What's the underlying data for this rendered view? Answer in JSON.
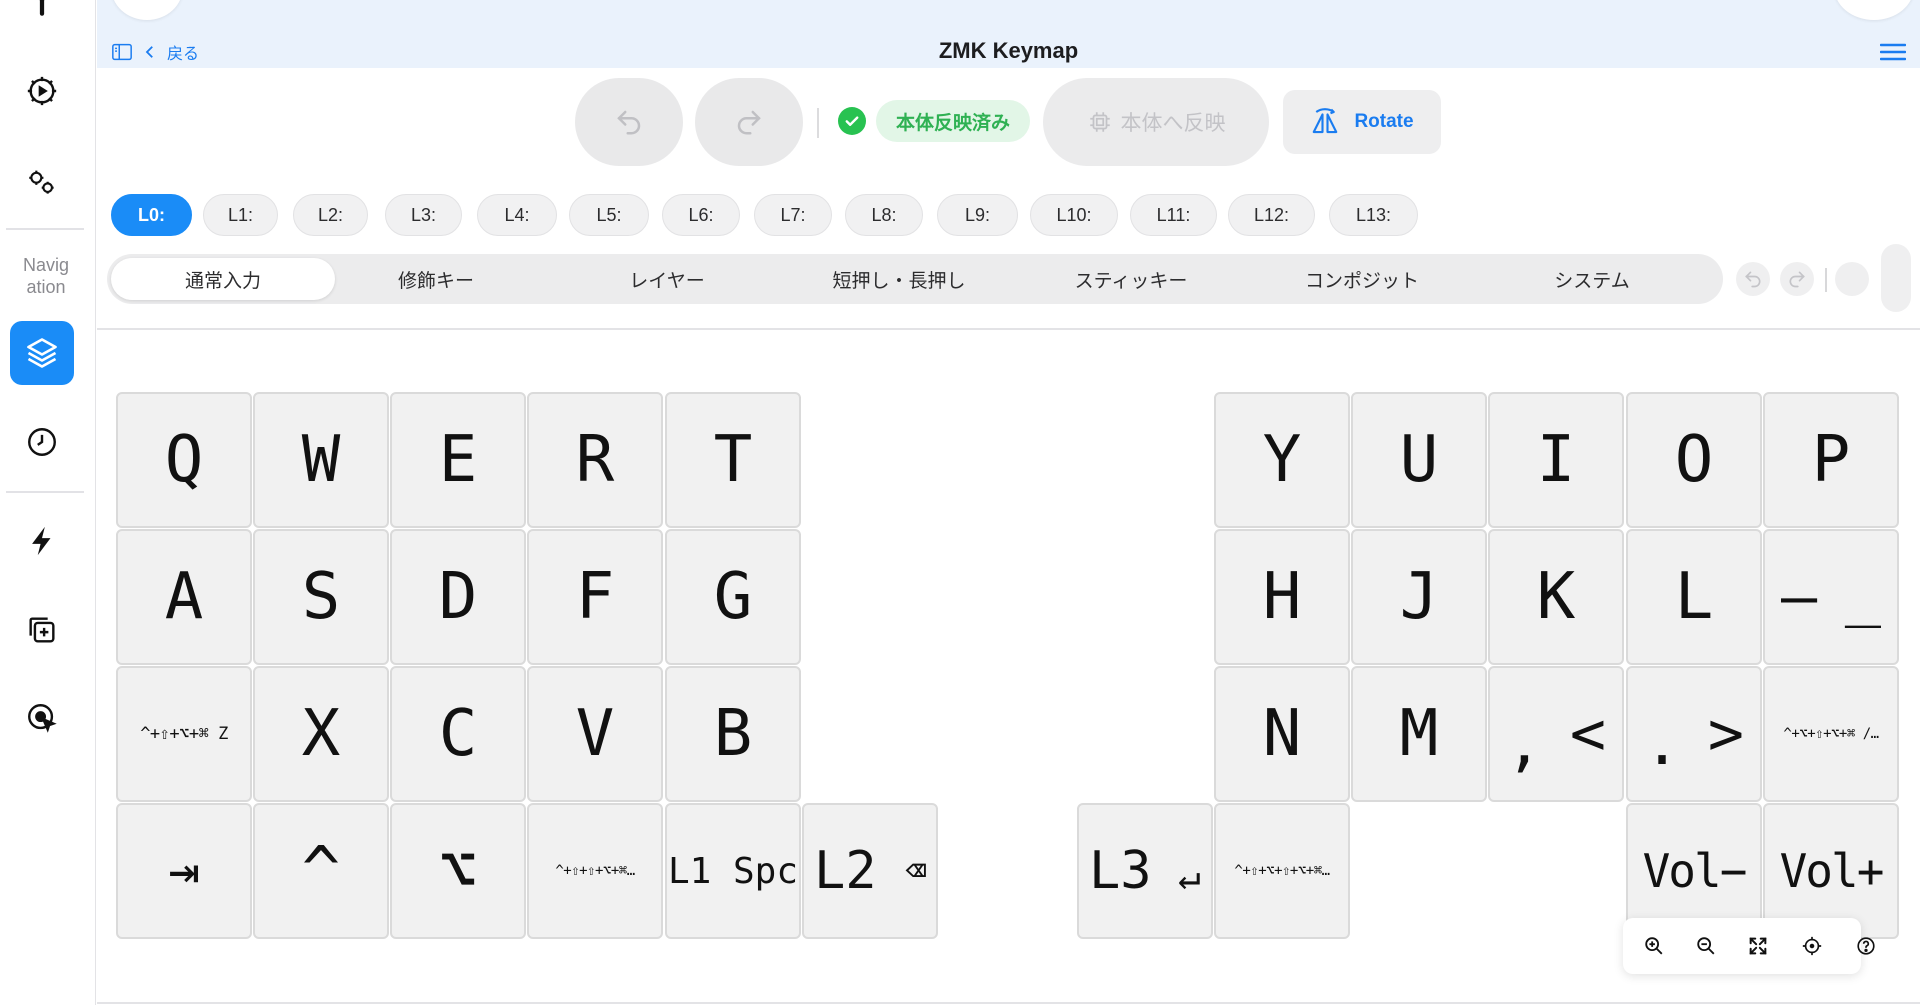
{
  "header": {
    "back_label": "戻る",
    "title": "ZMK Keymap"
  },
  "sidebar": {
    "nav_label": "Navig ation",
    "icons": [
      "pin-icon",
      "gear-play-icon",
      "gears-icon",
      "layers-icon",
      "clock-icon",
      "bolt-icon",
      "add-layer-icon",
      "cursor-target-icon"
    ]
  },
  "toolbar": {
    "undo_icon": "undo-icon",
    "redo_icon": "redo-icon",
    "synced_label": "本体反映済み",
    "apply_label": "本体へ反映",
    "rotate_label": "Rotate"
  },
  "layers": [
    "L0:",
    "L1:",
    "L2:",
    "L3:",
    "L4:",
    "L5:",
    "L6:",
    "L7:",
    "L8:",
    "L9:",
    "L10:",
    "L11:",
    "L12:",
    "L13:"
  ],
  "active_layer": "L0:",
  "categories": [
    "通常入力",
    "修飾キー",
    "レイヤー",
    "短押し・長押し",
    "スティッキー",
    "コンポジット",
    "システム"
  ],
  "active_category": "通常入力",
  "keys": {
    "q": "Q",
    "w": "W",
    "e": "E",
    "r": "R",
    "t": "T",
    "y": "Y",
    "u": "U",
    "i": "I",
    "o": "O",
    "p": "P",
    "a": "A",
    "s": "S",
    "d": "D",
    "f": "F",
    "g": "G",
    "h": "H",
    "j": "J",
    "k": "K",
    "l": "L",
    "minus_a": "–",
    "minus_b": "_",
    "z_mod": "^+⇧+⌥+⌘ Z",
    "x": "X",
    "c": "C",
    "v": "V",
    "b": "B",
    "n": "N",
    "m": "M",
    "comma_a": ",",
    "comma_b": "<",
    "period_a": ".",
    "period_b": ">",
    "slash_mod": "^+⌥+⇧+⌥+⌘ /…",
    "tab": "⇥",
    "ctrl": "^",
    "alt": "⌥",
    "hyper_left": "^+⇧+⇧+⌥+⌘…",
    "l1_spc": "L1 Spc",
    "l2": "L2",
    "l2_sub": "⌫",
    "l3": "L3",
    "l3_sub": "↵",
    "hyper_right": "^+⇧+⌥+⇧+⌥+⌘…",
    "vol_down": "Vol−",
    "vol_up": "Vol+"
  },
  "colors": {
    "accent": "#1a8cf7",
    "header_bg": "#eaf2fc",
    "synced_green": "#28c251",
    "key_bg": "#f1f1f1"
  },
  "zoom_controls": [
    "zoom-in-icon",
    "zoom-out-icon",
    "fit-icon",
    "recenter-icon",
    "help-icon"
  ]
}
